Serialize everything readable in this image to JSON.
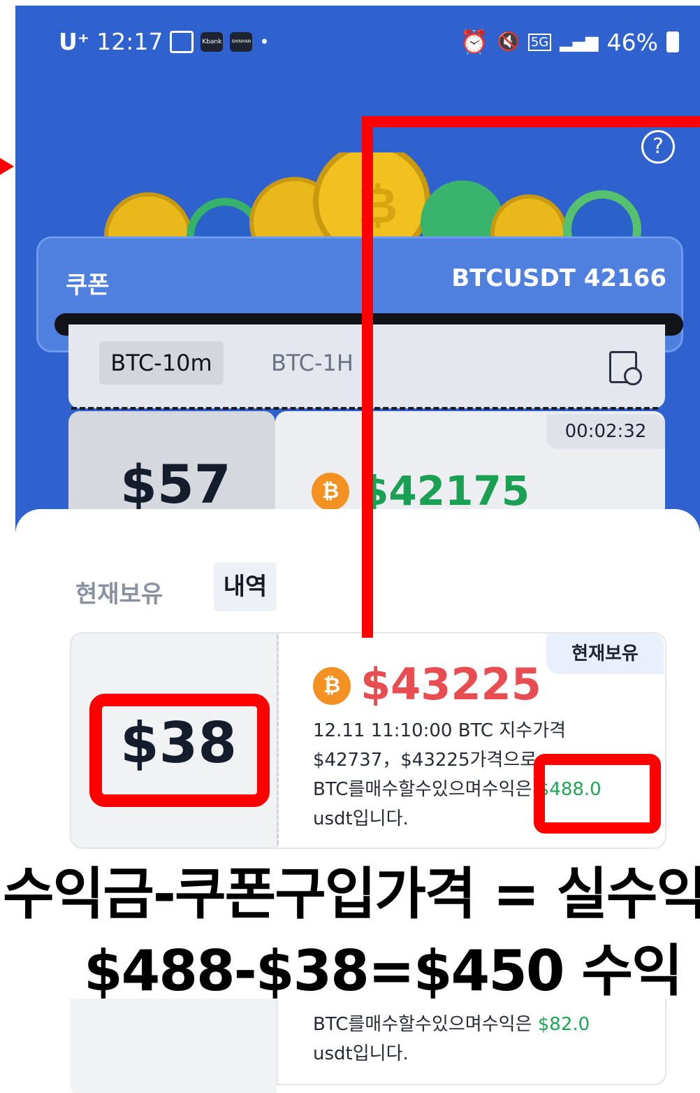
{
  "status_bar": {
    "carrier": "U⁺",
    "time": "12:17",
    "app_icon_kbank": "Kbank",
    "app_icon_third": "SHINHAN",
    "network": "5G",
    "battery": "46%"
  },
  "header": {
    "coupon_label": "쿠폰",
    "ticker": "BTCUSDT 42166",
    "help_label": "?"
  },
  "tabs": [
    {
      "label": "BTC-10m",
      "selected": true
    },
    {
      "label": "BTC-1H",
      "selected": false
    }
  ],
  "upper_card": {
    "price": "$57",
    "timer": "00:02:32",
    "btc_price": "$42175"
  },
  "sheet": {
    "tab_current": "현재보유",
    "tab_history": "내역"
  },
  "coupon_card": {
    "price": "$38",
    "badge": "현재보유",
    "btc_price": "$43225",
    "desc_line1": "12.11 11:10:00 BTC 지수가격",
    "desc_line2": "$42737，$43225가격으로",
    "desc_line3_prefix": "BTC를매수할수있으며수익",
    "desc_profit": "$488.0",
    "desc_line4": "usdt입니다."
  },
  "annotation": {
    "caption_line1": "수익금-쿠폰구입가격 = 실수익",
    "caption_line2": "$488-$38=$450 수익"
  },
  "coupon_card_2": {
    "desc_line1_prefix": "BTC를매수할수있으며수익은 ",
    "desc_profit": "$82.0",
    "desc_line2": "usdt입니다."
  },
  "colors": {
    "background_blue": "#2f62cf",
    "annotation_red": "#ff0000",
    "profit_green": "#1fa655",
    "price_red": "#e84d51",
    "btc_orange": "#f39222"
  }
}
